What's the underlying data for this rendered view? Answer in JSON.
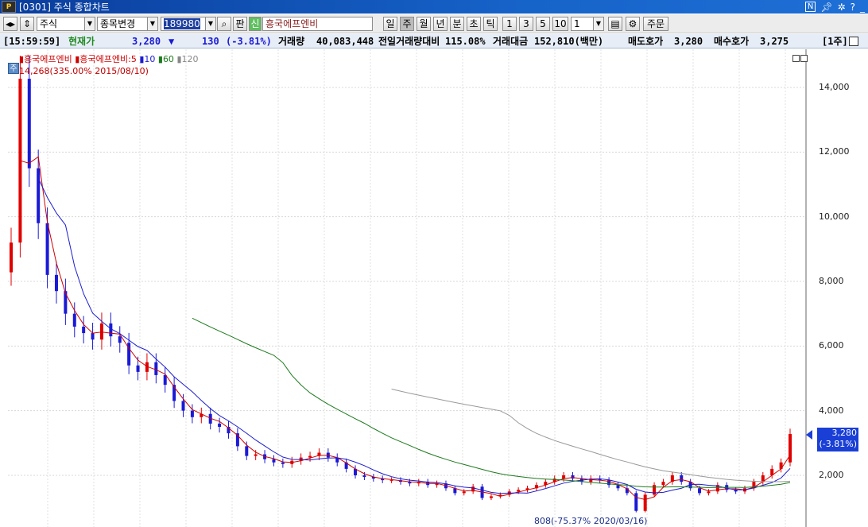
{
  "window": {
    "title": "[0301] 주식 종합차트",
    "logo": "P"
  },
  "title_controls": {
    "n_label": "N"
  },
  "toolbar": {
    "market": "주식",
    "change_stock": "종목변경",
    "code": "189980",
    "pan": "판",
    "sin": "신",
    "stock_name": "흥국에프엔비",
    "periods": [
      "일",
      "주",
      "월",
      "년",
      "분",
      "초",
      "틱"
    ],
    "active_period": "주",
    "intervals": [
      "1",
      "3",
      "5",
      "10"
    ],
    "count": "1",
    "order_label": "주문"
  },
  "quote": {
    "time": "[15:59:59]",
    "label": "현재가",
    "price": "3,280",
    "arrow": "▼",
    "change": "130",
    "change_pct": "(-3.81%)",
    "volume_label": "거래량",
    "volume": "40,083,448",
    "prev_ratio_label": "전일거래량대비",
    "prev_ratio": "115.08%",
    "amount_label": "거래대금",
    "amount": "152,810(백만)",
    "ask_label": "매도호가",
    "ask": "3,280",
    "bid_label": "매수호가",
    "bid": "3,275",
    "unit": "[1주]"
  },
  "legend": {
    "name": "흥국에프엔비",
    "ma_name": "흥국에프엔비",
    "ma5": "5",
    "ma10": "10",
    "ma60": "60",
    "ma120": "120"
  },
  "annotations": {
    "ju_badge": "주",
    "high": "14,268(335.00% 2015/08/10)",
    "low": "808(-75.37% 2020/03/16)"
  },
  "current_price_tag": {
    "price": "3,280",
    "pct": "(-3.81%)"
  },
  "colors": {
    "up": "#e00000",
    "down": "#1a1ad6",
    "ma5": "#d00000",
    "ma10": "#1c1cd0",
    "ma60": "#1c7a1c",
    "ma120": "#999999"
  },
  "chart_data": {
    "type": "line",
    "candlestick": true,
    "ylim": [
      0,
      15000
    ],
    "yticks": [
      "2,000",
      "4,000",
      "6,000",
      "8,000",
      "10,000",
      "12,000",
      "14,000"
    ],
    "ytick_values": [
      2000,
      4000,
      6000,
      8000,
      10000,
      12000,
      14000
    ],
    "grid": true,
    "series": [
      {
        "name": "흥국에프엔비",
        "values": [
          9200,
          14268,
          11500,
          9800,
          8200,
          7700,
          7000,
          6600,
          6400,
          6200,
          6700,
          6300,
          6100,
          5400,
          5200,
          5500,
          5100,
          4800,
          4300,
          4000,
          3800,
          3900,
          3600,
          3500,
          3300,
          2900,
          2600,
          2650,
          2500,
          2400,
          2350,
          2450,
          2550,
          2600,
          2700,
          2550,
          2400,
          2200,
          2000,
          1950,
          1900,
          1850,
          1850,
          1800,
          1750,
          1800,
          1700,
          1750,
          1600,
          1450,
          1500,
          1650,
          1300,
          1350,
          1400,
          1500,
          1550,
          1600,
          1700,
          1800,
          1900,
          2000,
          1900,
          1800,
          1900,
          1850,
          1700,
          1600,
          1450,
          900,
          1400,
          1700,
          1800,
          2000,
          1800,
          1600,
          1450,
          1500,
          1700,
          1550,
          1500,
          1600,
          1800,
          2000,
          2200,
          2400,
          3280
        ]
      },
      {
        "name": "5",
        "values": []
      },
      {
        "name": "10",
        "values": []
      },
      {
        "name": "60",
        "values": []
      },
      {
        "name": "120",
        "values": []
      }
    ]
  }
}
